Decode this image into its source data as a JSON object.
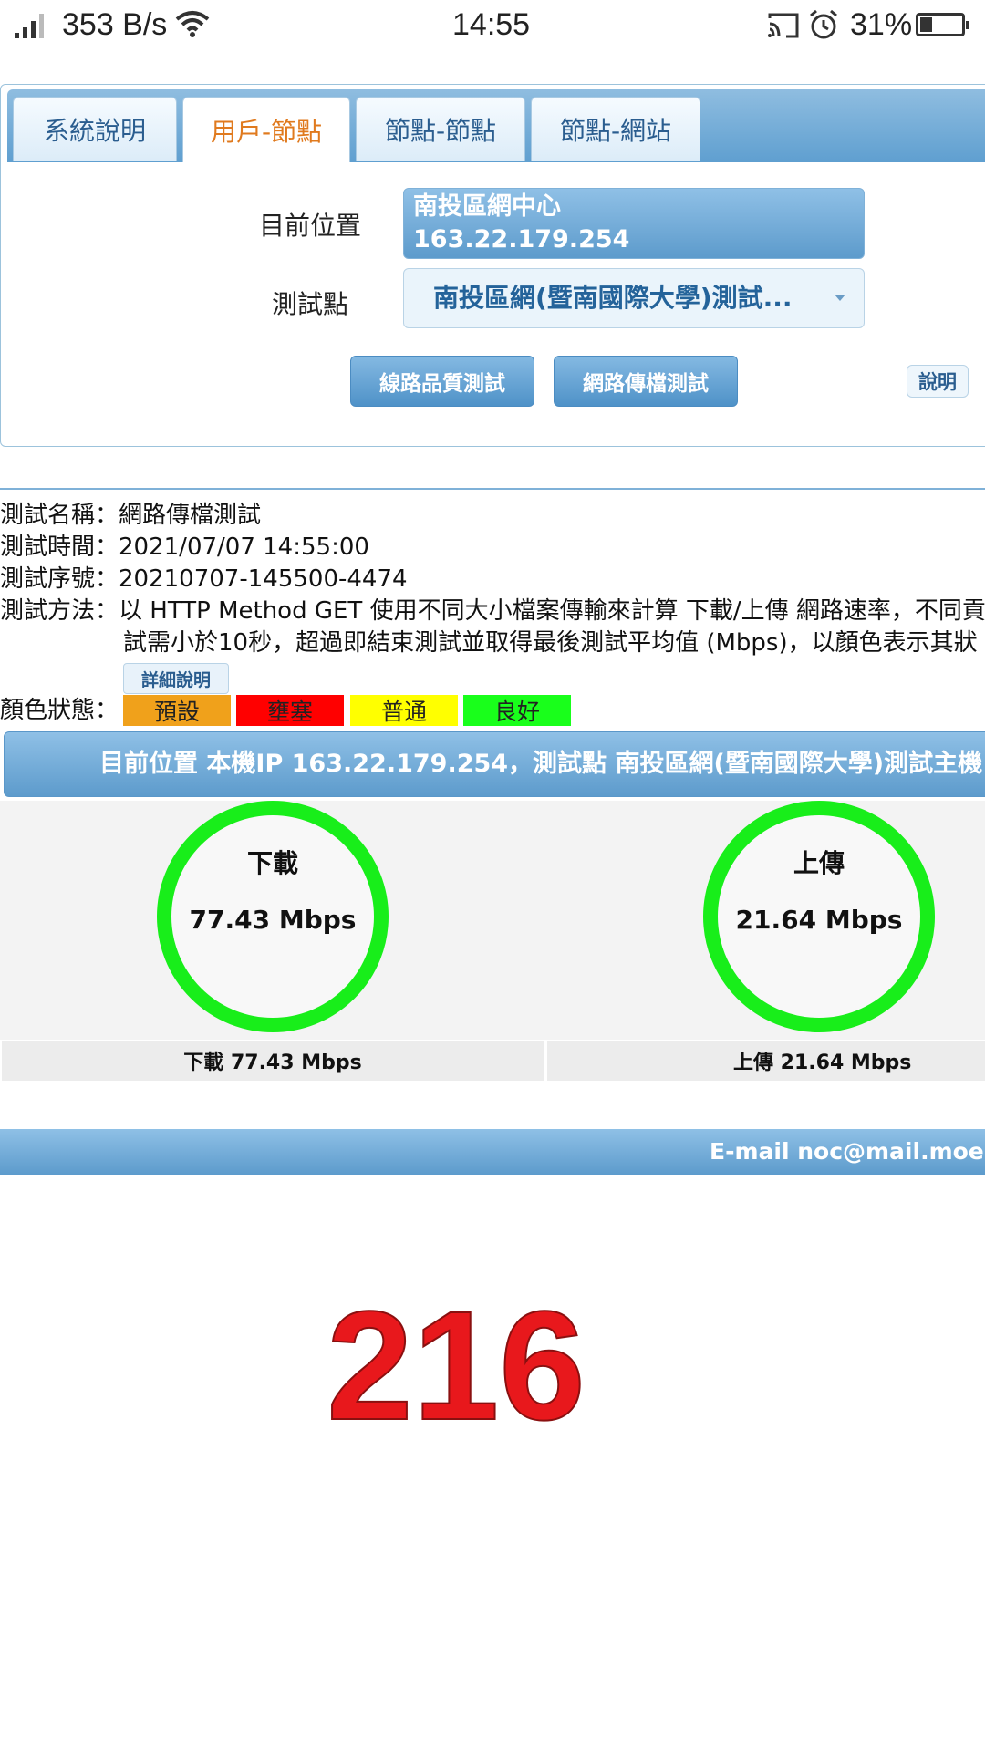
{
  "status_bar": {
    "speed": "353 B/s",
    "time": "14:55",
    "battery": "31%",
    "icons": [
      "signal-icon",
      "wifi-icon",
      "cast-icon",
      "alarm-icon",
      "battery-icon"
    ]
  },
  "tabs": [
    {
      "label": "系統說明",
      "active": false
    },
    {
      "label": "用戶-節點",
      "active": true
    },
    {
      "label": "節點-節點",
      "active": false
    },
    {
      "label": "節點-網站",
      "active": false
    }
  ],
  "form": {
    "location_label": "目前位置",
    "location_name": "南投區網中心",
    "location_ip": "163.22.179.254",
    "testpoint_label": "測試點",
    "testpoint_value": "南投區網(暨南國際大學)測試..."
  },
  "buttons": {
    "line_quality": "線路品質測試",
    "file_transfer": "網路傳檔測試",
    "help": "說明",
    "detail": "詳細說明"
  },
  "info": {
    "name_label": "測試名稱：",
    "name_value": "網路傳檔測試",
    "time_label": "測試時間：",
    "time_value": "2021/07/07 14:55:00",
    "serial_label": "測試序號：",
    "serial_value": "20210707-145500-4474",
    "method_label": "測試方法：",
    "method_line1": "以 HTTP Method GET 使用不同大小檔案傳輸來計算 下載/上傳 網路速率，不同貢",
    "method_line2": "試需小於10秒，超過即結束測試並取得最後測試平均值 (Mbps)，以顏色表示其狀",
    "color_label": "顏色狀態："
  },
  "legend": [
    {
      "label": "預設",
      "color": "#f0a11b"
    },
    {
      "label": "壅塞",
      "color": "#ff0000"
    },
    {
      "label": "普通",
      "color": "#ffff00"
    },
    {
      "label": "良好",
      "color": "#19ff1b"
    }
  ],
  "result": {
    "banner": "目前位置 本機IP 163.22.179.254，測試點 南投區網(暨南國際大學)測試主機",
    "download_title": "下載",
    "download_value": "77.43 Mbps",
    "upload_title": "上傳",
    "upload_value": "21.64 Mbps",
    "download_caption": "下載 77.43 Mbps",
    "upload_caption": "上傳 21.64 Mbps",
    "ring_color": "#18ee1a"
  },
  "footer": {
    "email_text": "E-mail noc@mail.moe.gov.tw"
  },
  "overlay_number": "216"
}
